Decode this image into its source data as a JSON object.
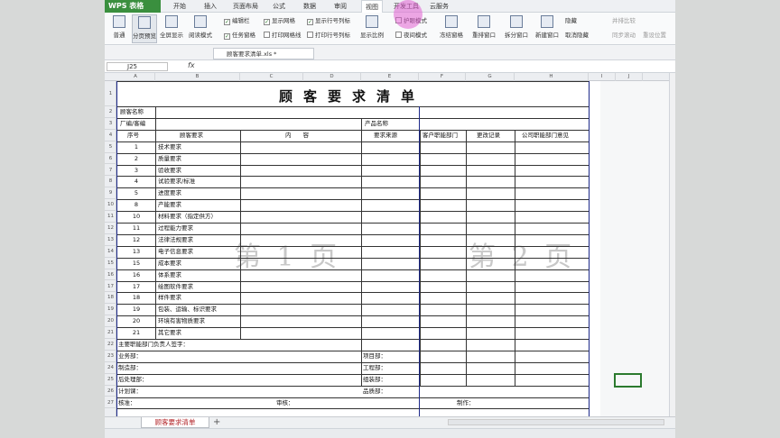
{
  "app": {
    "logo": "WPS 表格"
  },
  "menu": {
    "tabs": [
      "开始",
      "插入",
      "页面布局",
      "公式",
      "数据",
      "审阅",
      "视图",
      "开发工具",
      "云服务"
    ],
    "active": "视图"
  },
  "ribbon": {
    "buttons": [
      {
        "name": "normal-view",
        "label": "普通"
      },
      {
        "name": "page-break-preview",
        "label": "分页预览"
      },
      {
        "name": "fullscreen",
        "label": "全屏显示"
      },
      {
        "name": "reading-mode",
        "label": "阅读模式"
      },
      {
        "name": "zoom",
        "label": "显示比例"
      },
      {
        "name": "freeze-panes",
        "label": "冻结窗格"
      },
      {
        "name": "rearrange",
        "label": "重排窗口"
      },
      {
        "name": "split",
        "label": "拆分窗口"
      },
      {
        "name": "new-window",
        "label": "新建窗口"
      },
      {
        "name": "cancel-hide",
        "label": "取消隐藏"
      }
    ],
    "checks": [
      {
        "label": "编辑栏",
        "checked": true
      },
      {
        "label": "任务窗格",
        "checked": true
      },
      {
        "label": "显示网格",
        "checked": true
      },
      {
        "label": "打印网格线",
        "checked": false
      },
      {
        "label": "显示行号列标",
        "checked": true
      },
      {
        "label": "打印行号列标",
        "checked": false
      },
      {
        "label": "护眼模式",
        "checked": false
      },
      {
        "label": "夜间模式",
        "checked": false
      }
    ],
    "right": [
      "隐藏",
      "并排比较",
      "同步滚动",
      "重设位置"
    ]
  },
  "doc": {
    "filename": "顾客要求清单.xls *"
  },
  "formula": {
    "cell": "J25",
    "fx": "fx"
  },
  "columns": [
    "A",
    "B",
    "C",
    "D",
    "E",
    "F",
    "G",
    "H",
    "I",
    "J"
  ],
  "rows": [
    "1",
    "2",
    "3",
    "4",
    "5",
    "6",
    "7",
    "8",
    "9",
    "10",
    "11",
    "12",
    "13",
    "14",
    "15",
    "16",
    "17",
    "18",
    "19",
    "20",
    "21",
    "22",
    "23",
    "24",
    "25",
    "26",
    "27"
  ],
  "sheet": {
    "title": "顾客要求清单",
    "labels": {
      "customer": "顾客名称",
      "factory": "厂编/客编",
      "product": "产品名称",
      "seq": "序号",
      "req": "顾客要求",
      "content": "内　　容",
      "source": "要求来源",
      "dept": "客户职能部门",
      "change": "更改记录",
      "opinion": "公司职能部门意见"
    },
    "items": [
      {
        "no": "1",
        "req": "技术要求"
      },
      {
        "no": "2",
        "req": "质量要求"
      },
      {
        "no": "3",
        "req": "验收要求"
      },
      {
        "no": "4",
        "req": "试验要求/标准"
      },
      {
        "no": "5",
        "req": "进度要求"
      },
      {
        "no": "8",
        "req": "产能要求"
      },
      {
        "no": "10",
        "req": "材料要求（指定供方）"
      },
      {
        "no": "11",
        "req": "过程能力要求"
      },
      {
        "no": "12",
        "req": "法律法规要求"
      },
      {
        "no": "13",
        "req": "电子信息要求"
      },
      {
        "no": "15",
        "req": "成本要求"
      },
      {
        "no": "16",
        "req": "体系要求"
      },
      {
        "no": "17",
        "req": "绘图软件要求"
      },
      {
        "no": "18",
        "req": "样件要求"
      },
      {
        "no": "19",
        "req": "包装、运输、标识要求"
      },
      {
        "no": "20",
        "req": "环境有害物质要求"
      },
      {
        "no": "21",
        "req": "其它要求"
      }
    ],
    "footer": {
      "sign": "主要职能部门负责人签字：",
      "sales": "业务部：",
      "prod": "制造部：",
      "after": "后处理部：",
      "plan": "计划课：",
      "project": "项目部：",
      "eng": "工程部：",
      "assembly": "组装部：",
      "quality": "品质部：",
      "approve": "核准：",
      "review": "审核：",
      "make": "制作："
    },
    "watermark1": "第 1 页",
    "watermark2": "第 2 页"
  },
  "sheettab": "顾客要求清单"
}
